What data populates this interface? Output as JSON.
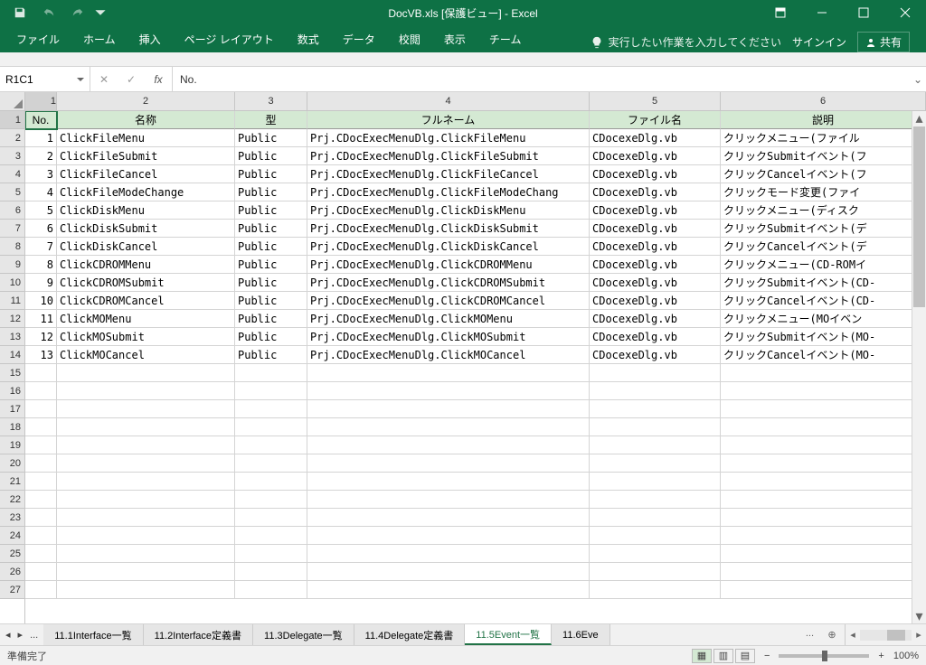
{
  "titlebar": {
    "title": "DocVB.xls [保護ビュー] - Excel"
  },
  "ribbon": {
    "tabs": [
      "ファイル",
      "ホーム",
      "挿入",
      "ページ レイアウト",
      "数式",
      "データ",
      "校閲",
      "表示",
      "チーム"
    ],
    "tellme": "実行したい作業を入力してください",
    "signin": "サインイン",
    "share": "共有"
  },
  "namebox": "R1C1",
  "formula": "No.",
  "columns": [
    "1",
    "2",
    "3",
    "4",
    "5",
    "6"
  ],
  "headers": [
    "No.",
    "名称",
    "型",
    "フルネーム",
    "ファイル名",
    "説明"
  ],
  "rows": [
    {
      "no": "1",
      "name": "ClickFileMenu",
      "type": "Public",
      "full": "Prj.CDocExecMenuDlg.ClickFileMenu",
      "file": "CDocexeDlg.vb",
      "desc": "クリックメニュー(ファイル"
    },
    {
      "no": "2",
      "name": "ClickFileSubmit",
      "type": "Public",
      "full": "Prj.CDocExecMenuDlg.ClickFileSubmit",
      "file": "CDocexeDlg.vb",
      "desc": "クリックSubmitイベント(フ"
    },
    {
      "no": "3",
      "name": "ClickFileCancel",
      "type": "Public",
      "full": "Prj.CDocExecMenuDlg.ClickFileCancel",
      "file": "CDocexeDlg.vb",
      "desc": "クリックCancelイベント(フ"
    },
    {
      "no": "4",
      "name": "ClickFileModeChange",
      "type": "Public",
      "full": "Prj.CDocExecMenuDlg.ClickFileModeChang",
      "file": "CDocexeDlg.vb",
      "desc": "クリックモード変更(ファイ"
    },
    {
      "no": "5",
      "name": "ClickDiskMenu",
      "type": "Public",
      "full": "Prj.CDocExecMenuDlg.ClickDiskMenu",
      "file": "CDocexeDlg.vb",
      "desc": "クリックメニュー(ディスク"
    },
    {
      "no": "6",
      "name": "ClickDiskSubmit",
      "type": "Public",
      "full": "Prj.CDocExecMenuDlg.ClickDiskSubmit",
      "file": "CDocexeDlg.vb",
      "desc": "クリックSubmitイベント(デ"
    },
    {
      "no": "7",
      "name": "ClickDiskCancel",
      "type": "Public",
      "full": "Prj.CDocExecMenuDlg.ClickDiskCancel",
      "file": "CDocexeDlg.vb",
      "desc": "クリックCancelイベント(デ"
    },
    {
      "no": "8",
      "name": "ClickCDROMMenu",
      "type": "Public",
      "full": "Prj.CDocExecMenuDlg.ClickCDROMMenu",
      "file": "CDocexeDlg.vb",
      "desc": "クリックメニュー(CD-ROMイ"
    },
    {
      "no": "9",
      "name": "ClickCDROMSubmit",
      "type": "Public",
      "full": "Prj.CDocExecMenuDlg.ClickCDROMSubmit",
      "file": "CDocexeDlg.vb",
      "desc": "クリックSubmitイベント(CD-"
    },
    {
      "no": "10",
      "name": "ClickCDROMCancel",
      "type": "Public",
      "full": "Prj.CDocExecMenuDlg.ClickCDROMCancel",
      "file": "CDocexeDlg.vb",
      "desc": "クリックCancelイベント(CD-"
    },
    {
      "no": "11",
      "name": "ClickMOMenu",
      "type": "Public",
      "full": "Prj.CDocExecMenuDlg.ClickMOMenu",
      "file": "CDocexeDlg.vb",
      "desc": "クリックメニュー(MOイベン"
    },
    {
      "no": "12",
      "name": "ClickMOSubmit",
      "type": "Public",
      "full": "Prj.CDocExecMenuDlg.ClickMOSubmit",
      "file": "CDocexeDlg.vb",
      "desc": "クリックSubmitイベント(MO-"
    },
    {
      "no": "13",
      "name": "ClickMOCancel",
      "type": "Public",
      "full": "Prj.CDocExecMenuDlg.ClickMOCancel",
      "file": "CDocexeDlg.vb",
      "desc": "クリックCancelイベント(MO-"
    }
  ],
  "emptyRowCount": 13,
  "sheettabs": {
    "items": [
      "11.1Interface一覧",
      "11.2Interface定義書",
      "11.3Delegate一覧",
      "11.4Delegate定義書",
      "11.5Event一覧",
      "11.6Eve"
    ],
    "activeIndex": 4,
    "ellipsisLeft": "...",
    "ellipsisRight": "..."
  },
  "statusbar": {
    "ready": "準備完了",
    "zoom": "100%"
  }
}
